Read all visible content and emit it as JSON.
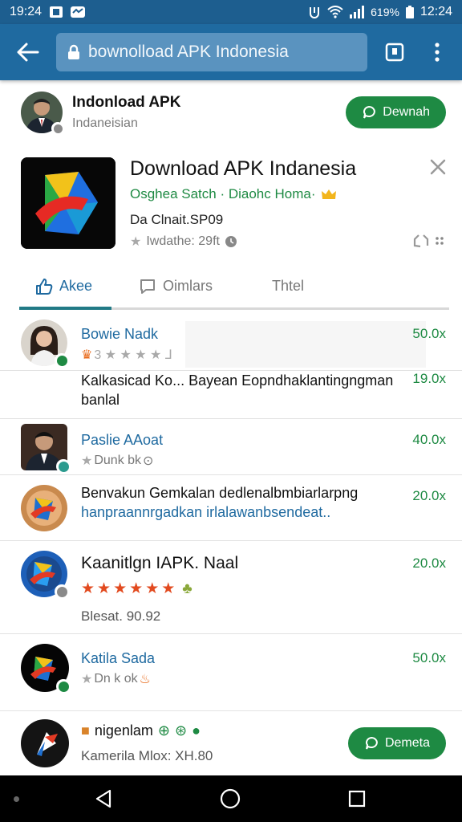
{
  "status_bar": {
    "left_time": "19:24",
    "battery": "619%",
    "clock": "12:24"
  },
  "browser": {
    "url": "bownolload APK Indonesia"
  },
  "publisher": {
    "name": "Indonload APK",
    "subtitle": "Indaneisian",
    "button_label": "Dewnah"
  },
  "app": {
    "title": "Download APK Indanesia",
    "developer": "Osghea Satch · Diaohc Homa·",
    "meta": "Da Clnait.SP09",
    "rating_text": "Iwdathe: 29ft"
  },
  "tabs": [
    {
      "label": "Akee",
      "active": true
    },
    {
      "label": "Oimlars",
      "active": false
    },
    {
      "label": "Thtel",
      "active": false
    }
  ],
  "list": [
    {
      "title": "Bowie Nadk",
      "stars_text": "3 ★ ★ ★ ★ ⅃",
      "value": "50.0x"
    },
    {
      "desc": "Kalkasicad Ko... Bayean Eopndhaklantingngman banlal",
      "value": "19.0x"
    },
    {
      "title": "Paslie AAoat",
      "stars_text": "Dunk bk",
      "value": "40.0x"
    },
    {
      "desc_line1": "Benvakun Gemkalan dedlenalbmbiarlarpng",
      "desc_line2": "hanpraannrgadkan irlalawanbsendeat..",
      "value": "20.0x"
    },
    {
      "title": "Kaanitlgn IAPK. Naal",
      "sub": "Blesat. 90.92",
      "value": "20.0x"
    },
    {
      "title": "Katila Sada",
      "stars_text": "Dn k ok",
      "value": "50.0x"
    },
    {
      "title": "nigenlam",
      "sub": "Kamerila Mlox: XH.80",
      "button_label": "Demeta"
    }
  ]
}
